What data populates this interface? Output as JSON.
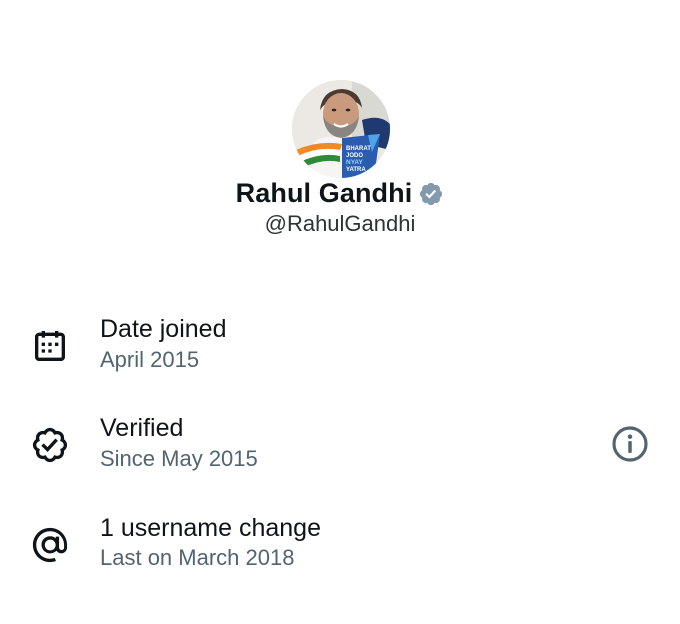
{
  "profile": {
    "display_name": "Rahul Gandhi",
    "handle": "@RahulGandhi",
    "verified": true,
    "avatar_icon": "profile-photo",
    "avatar_banner_text": [
      "BHARAT",
      "JODO",
      "NYAY",
      "YATRA"
    ]
  },
  "about": {
    "rows": [
      {
        "icon": "calendar-icon",
        "title": "Date joined",
        "subtitle": "April 2015"
      },
      {
        "icon": "verified-badge-icon",
        "title": "Verified",
        "subtitle": "Since May 2015",
        "action_icon": "info-icon"
      },
      {
        "icon": "at-sign-icon",
        "title": "1 username change",
        "subtitle": "Last on March 2018"
      }
    ]
  },
  "colors": {
    "primary_text": "#0f1419",
    "secondary_text": "#536471",
    "verified_badge": "#829aab",
    "background": "#ffffff"
  }
}
